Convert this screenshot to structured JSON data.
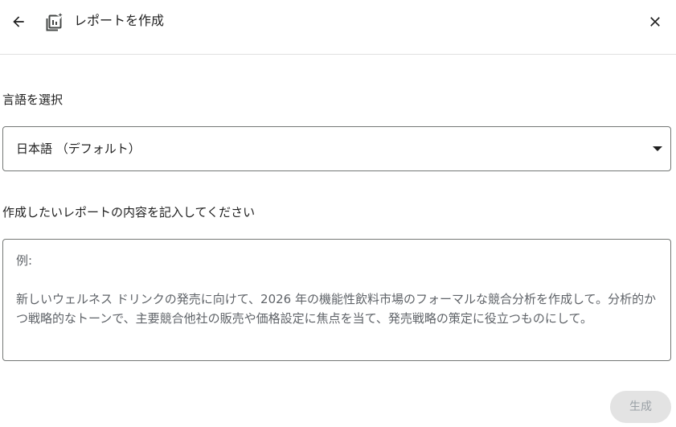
{
  "header": {
    "title": "レポートを作成",
    "back_icon": "arrow-back-icon",
    "report_icon": "report-sparkle-icon",
    "close_icon": "close-icon"
  },
  "language": {
    "label": "言語を選択",
    "selected": "日本語 （デフォルト）"
  },
  "content": {
    "label": "作成したいレポートの内容を記入してください",
    "placeholder": "例:\n\n新しいウェルネス ドリンクの発売に向けて、2026 年の機能性飲料市場のフォーマルな競合分析を作成して。分析的かつ戦略的なトーンで、主要競合他社の販売や価格設定に焦点を当て、発売戦略の策定に役立つものにして。",
    "value": ""
  },
  "actions": {
    "generate_label": "生成",
    "generate_disabled": true
  },
  "colors": {
    "border": "#747775",
    "divider": "#e0e0e0",
    "button_disabled_bg": "#e3e3e3",
    "button_disabled_text": "#9aa0a6"
  }
}
